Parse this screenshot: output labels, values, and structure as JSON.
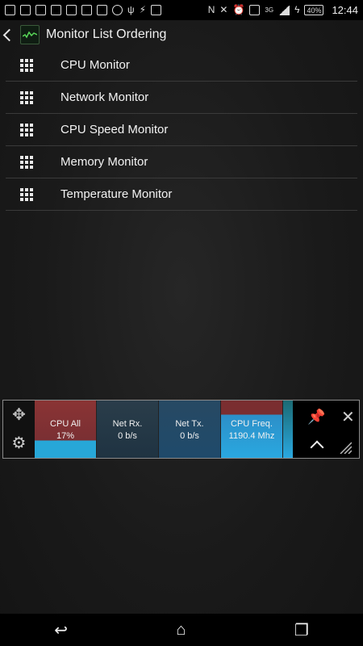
{
  "status_bar": {
    "battery": "40%",
    "time": "12:44",
    "network": "3G"
  },
  "action_bar": {
    "title": "Monitor List Ordering"
  },
  "monitors": [
    {
      "label": "CPU Monitor"
    },
    {
      "label": "Network Monitor"
    },
    {
      "label": "CPU Speed Monitor"
    },
    {
      "label": "Memory Monitor"
    },
    {
      "label": "Temperature Monitor"
    }
  ],
  "widget": {
    "tiles": [
      {
        "name": "CPU All",
        "value": "17%"
      },
      {
        "name": "Net Rx.",
        "value": "0 b/s"
      },
      {
        "name": "Net Tx.",
        "value": "0 b/s"
      },
      {
        "name": "CPU Freq.",
        "value": "1190.4 Mhz"
      }
    ]
  },
  "icons": {
    "drag": "drag-handle-icon",
    "move": "move-icon",
    "settings": "gear-icon",
    "pin": "pin-icon",
    "close": "close-icon",
    "expand": "chevron-up-icon",
    "resize": "resize-icon"
  }
}
